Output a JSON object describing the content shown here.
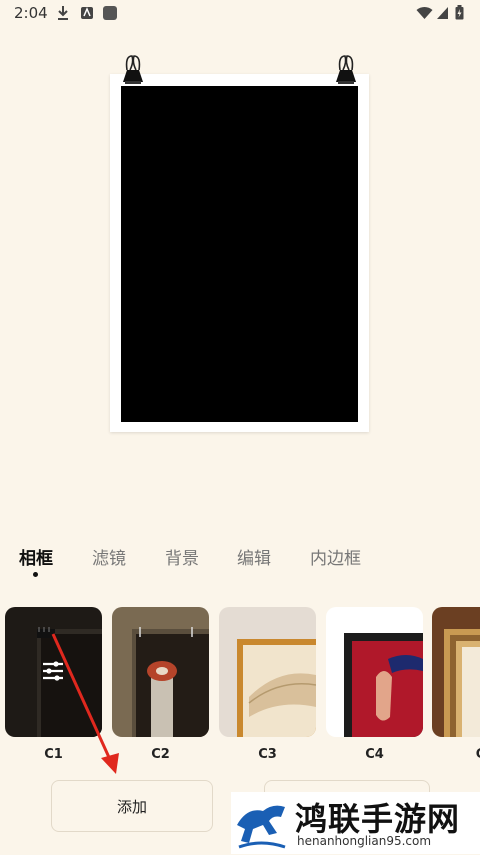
{
  "status_bar": {
    "time": "2:04"
  },
  "tabs": [
    {
      "label": "相框",
      "active": true
    },
    {
      "label": "滤镜",
      "active": false
    },
    {
      "label": "背景",
      "active": false
    },
    {
      "label": "编辑",
      "active": false
    },
    {
      "label": "内边框",
      "active": false
    }
  ],
  "frames": [
    {
      "label": "C1"
    },
    {
      "label": "C2"
    },
    {
      "label": "C3"
    },
    {
      "label": "C4"
    },
    {
      "label": "C"
    }
  ],
  "actions": {
    "add_label": "添加"
  },
  "watermark": {
    "text": "鸿联手游网",
    "url": "henanhonglian95.com"
  },
  "colors": {
    "background": "#fbf5ea",
    "annotation_arrow": "#e0281e",
    "photo": "#000000"
  }
}
